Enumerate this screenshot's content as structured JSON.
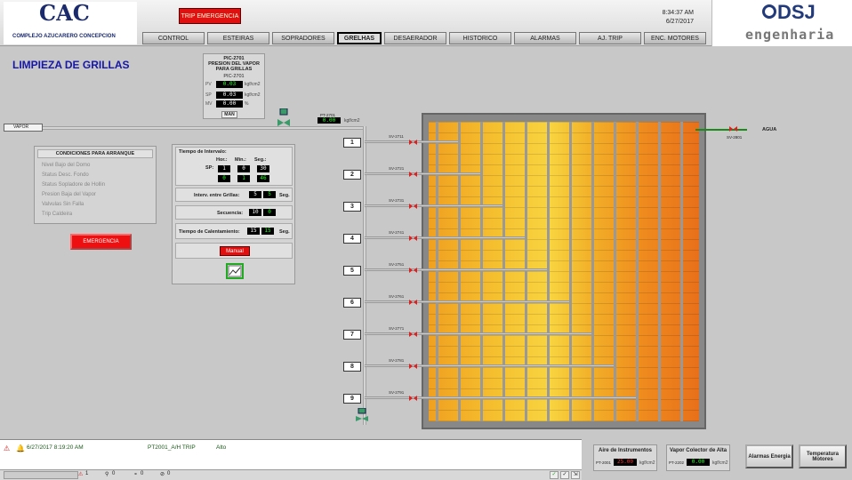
{
  "header": {
    "company_initials": "CAC",
    "company_name": "COMPLEJO AZUCARERO CONCEPCION",
    "trip_button": "TRIP EMERGENCIA",
    "time": "8:34:37 AM",
    "date": "6/27/2017",
    "tabs": [
      "CONTROL",
      "ESTEIRAS",
      "SOPRADORES",
      "GRELHAS",
      "DESAERADOR",
      "HISTORICO",
      "ALARMAS",
      "AJ. TRIP",
      "ENC. MOTORES"
    ],
    "active_tab": "GRELHAS",
    "brand": "DSJ",
    "brand_sub": "engenharia"
  },
  "page_title": "LIMPIEZA DE GRILLAS",
  "pic": {
    "tag": "PIC-2701",
    "line1": "PRESION DEL VAPOR",
    "line2": "PARA GRILLAS",
    "subtag": "PIC-2701",
    "pv_label": "PV",
    "pv": "0.03",
    "sp_label": "SP",
    "sp": "0.03",
    "mv_label": "MV",
    "mv": "0.00",
    "unit": "kgf/cm2",
    "mv_unit": "%",
    "mode": "MAN"
  },
  "vapor_label": "VAPOR",
  "pt_line": {
    "tag": "PT-2701",
    "value": "0.00",
    "unit": "kgf/cm2"
  },
  "conditions": {
    "title": "CONDICIONES PARA ARRANQUE",
    "items": [
      "Nivel Bajo del Domo",
      "Status Desc. Fondo",
      "Status Sopladore de Hollin",
      "Presion Baja del Vapor",
      "Valvulas Sin Falla",
      "Trip Caldeira"
    ]
  },
  "emergency_button": "EMERGENCIA",
  "timer": {
    "interval_title": "Tiempo de Intervalo:",
    "col_hr": "Hor.:",
    "col_min": "Min.:",
    "col_seg": "Seg.:",
    "sp_label": "SP:",
    "sp_hr": "1",
    "sp_min": "0",
    "sp_seg": "30",
    "pv_hr": "0",
    "pv_min": "1",
    "pv_seg": "46",
    "interv_label": "Interv. entre Grillas:",
    "interv_sp": "5",
    "interv_pv": "5",
    "interv_unit": "Seg.",
    "seq_label": "Secuencia:",
    "seq_sp": "10",
    "seq_pv": "0",
    "heat_label": "Tiempo de Calentamiento:",
    "heat_sp": "15",
    "heat_pv": "15",
    "heat_unit": "Seg.",
    "manual_button": "Manual"
  },
  "grid_numbers": [
    "1",
    "2",
    "3",
    "4",
    "5",
    "6",
    "7",
    "8",
    "9"
  ],
  "sv_tags": [
    "SV-2711",
    "SV-2721",
    "SV-2731",
    "SV-2741",
    "SV-2751",
    "SV-2761",
    "SV-2771",
    "SV-2781",
    "SV-2791"
  ],
  "agua": {
    "label": "AGUA",
    "valve": "SV-2801"
  },
  "alarm": {
    "timestamp": "6/27/2017 8:19:20 AM",
    "message": "PT2001_A/H TRIP",
    "level": "Alto",
    "counts": [
      "1",
      "0",
      "0",
      "0"
    ]
  },
  "instruments": {
    "air_title": "Aire de Instrumentos",
    "air_tag": "PT-2001",
    "air_value": "25.00",
    "air_unit": "kgf/cm2",
    "steam_title": "Vapor Colector de Alta",
    "steam_tag": "PT-2202",
    "steam_value": "0.00",
    "steam_unit": "kgf/cm2"
  },
  "buttons": {
    "alarms_energy": "Alarmas Energia",
    "motor_temp": "Temperatura Motores"
  },
  "colors": {
    "accent_title": "#1616a8",
    "alarm_red": "#e01010",
    "value_green": "#22ff22"
  }
}
